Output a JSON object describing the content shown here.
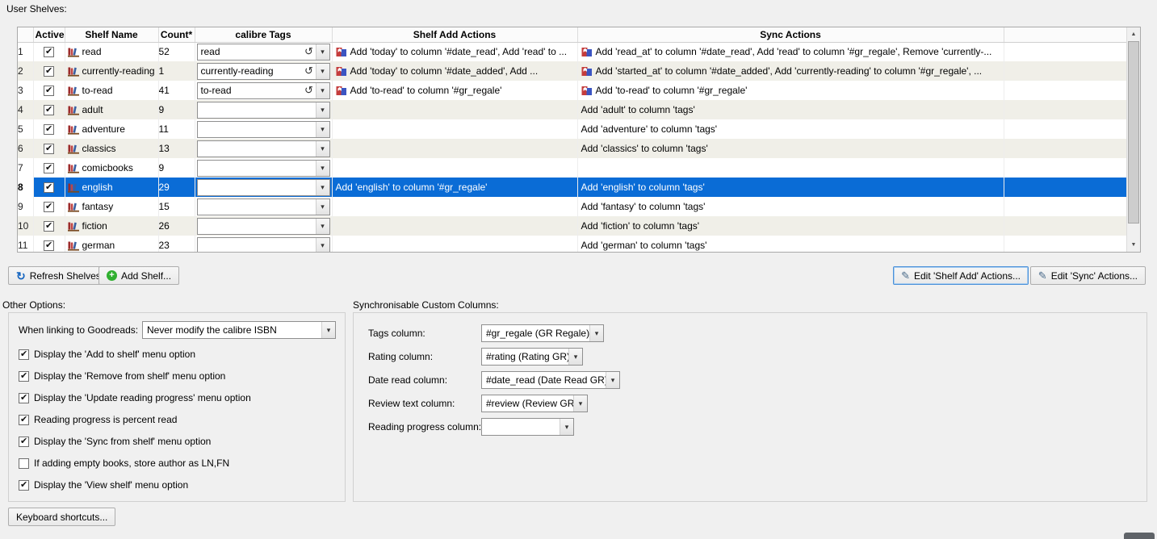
{
  "labels": {
    "user_shelves": "User Shelves:",
    "other_options": "Other Options:",
    "sync_columns": "Synchronisable Custom Columns:"
  },
  "icons": {
    "refresh_glyph": "↻",
    "tag_refresh_glyph": "↺",
    "dropdown_glyph": "▾",
    "plus_glyph": "+",
    "edit_glyph": "✎",
    "up_glyph": "▲",
    "down_glyph": "▼",
    "shelf_icon": "bookshelf-icon",
    "action_icon": "shelf-action-icon"
  },
  "colors": {
    "selection": "#0a6cd6",
    "alt_row": "#f0efe8",
    "background": "#f0f0f0",
    "add_green": "#2faf2f",
    "refresh_blue": "#1565c0"
  },
  "table": {
    "headers": {
      "active": "Active",
      "shelf_name": "Shelf Name",
      "count": "Count*",
      "tags": "calibre Tags",
      "add_actions": "Shelf Add Actions",
      "sync_actions": "Sync Actions"
    },
    "rows": [
      {
        "num": "1",
        "active": true,
        "shelf": "read",
        "count": "52",
        "tag": "read",
        "tag_refresh": true,
        "add_icon": true,
        "add": "Add 'today' to column '#date_read', Add 'read' to ...",
        "sync_icon": true,
        "sync": "Add 'read_at' to column '#date_read', Add 'read' to column '#gr_regale', Remove 'currently-...",
        "selected": false
      },
      {
        "num": "2",
        "active": true,
        "shelf": "currently-reading",
        "count": "1",
        "tag": "currently-reading",
        "tag_refresh": true,
        "add_icon": true,
        "add": "Add 'today' to column '#date_added', Add ...",
        "sync_icon": true,
        "sync": "Add 'started_at' to column '#date_added', Add 'currently-reading' to column '#gr_regale', ...",
        "selected": false
      },
      {
        "num": "3",
        "active": true,
        "shelf": "to-read",
        "count": "41",
        "tag": "to-read",
        "tag_refresh": true,
        "add_icon": true,
        "add": "Add 'to-read' to column '#gr_regale'",
        "sync_icon": true,
        "sync": "Add 'to-read' to column '#gr_regale'",
        "selected": false
      },
      {
        "num": "4",
        "active": true,
        "shelf": "adult",
        "count": "9",
        "tag": "",
        "tag_refresh": false,
        "add_icon": false,
        "add": "",
        "sync_icon": false,
        "sync": "Add 'adult' to column 'tags'",
        "selected": false
      },
      {
        "num": "5",
        "active": true,
        "shelf": "adventure",
        "count": "11",
        "tag": "",
        "tag_refresh": false,
        "add_icon": false,
        "add": "",
        "sync_icon": false,
        "sync": "Add 'adventure' to column 'tags'",
        "selected": false
      },
      {
        "num": "6",
        "active": true,
        "shelf": "classics",
        "count": "13",
        "tag": "",
        "tag_refresh": false,
        "add_icon": false,
        "add": "",
        "sync_icon": false,
        "sync": "Add 'classics' to column 'tags'",
        "selected": false
      },
      {
        "num": "7",
        "active": true,
        "shelf": "comicbooks",
        "count": "9",
        "tag": "",
        "tag_refresh": false,
        "add_icon": false,
        "add": "",
        "sync_icon": false,
        "sync": "",
        "selected": false
      },
      {
        "num": "8",
        "active": true,
        "shelf": "english",
        "count": "29",
        "tag": "",
        "tag_refresh": false,
        "add_icon": false,
        "add": "Add 'english' to column '#gr_regale'",
        "sync_icon": false,
        "sync": "Add 'english' to column 'tags'",
        "selected": true
      },
      {
        "num": "9",
        "active": true,
        "shelf": "fantasy",
        "count": "15",
        "tag": "",
        "tag_refresh": false,
        "add_icon": false,
        "add": "",
        "sync_icon": false,
        "sync": "Add 'fantasy' to column 'tags'",
        "selected": false
      },
      {
        "num": "10",
        "active": true,
        "shelf": "fiction",
        "count": "26",
        "tag": "",
        "tag_refresh": false,
        "add_icon": false,
        "add": "",
        "sync_icon": false,
        "sync": "Add 'fiction' to column 'tags'",
        "selected": false
      },
      {
        "num": "11",
        "active": true,
        "shelf": "german",
        "count": "23",
        "tag": "",
        "tag_refresh": false,
        "add_icon": false,
        "add": "",
        "sync_icon": false,
        "sync": "Add 'german' to column 'tags'",
        "selected": false
      }
    ]
  },
  "buttons": {
    "refresh_shelves": "Refresh Shelves",
    "add_shelf": "Add Shelf...",
    "edit_shelf_add": "Edit 'Shelf Add' Actions...",
    "edit_sync": "Edit 'Sync' Actions...",
    "keyboard_shortcuts": "Keyboard shortcuts..."
  },
  "other_options": {
    "linking_label": "When linking to Goodreads:",
    "linking_value": "Never modify the calibre ISBN",
    "checkboxes": [
      {
        "label": "Display the 'Add to shelf' menu option",
        "checked": true
      },
      {
        "label": "Display the 'Remove from shelf' menu option",
        "checked": true
      },
      {
        "label": "Display the 'Update reading progress' menu option",
        "checked": true
      },
      {
        "label": "Reading progress is percent read",
        "checked": true
      },
      {
        "label": "Display the 'Sync from shelf' menu option",
        "checked": true
      },
      {
        "label": "If adding empty books, store author as LN,FN",
        "checked": false
      },
      {
        "label": "Display the 'View shelf' menu option",
        "checked": true
      }
    ]
  },
  "sync_columns": {
    "rows": [
      {
        "label": "Tags column:",
        "value": "#gr_regale (GR Regale)"
      },
      {
        "label": "Rating column:",
        "value": "#rating (Rating GR)"
      },
      {
        "label": "Date read column:",
        "value": "#date_read (Date Read GR)"
      },
      {
        "label": "Review text column:",
        "value": "#review (Review GR)"
      },
      {
        "label": "Reading progress column:",
        "value": ""
      }
    ]
  }
}
